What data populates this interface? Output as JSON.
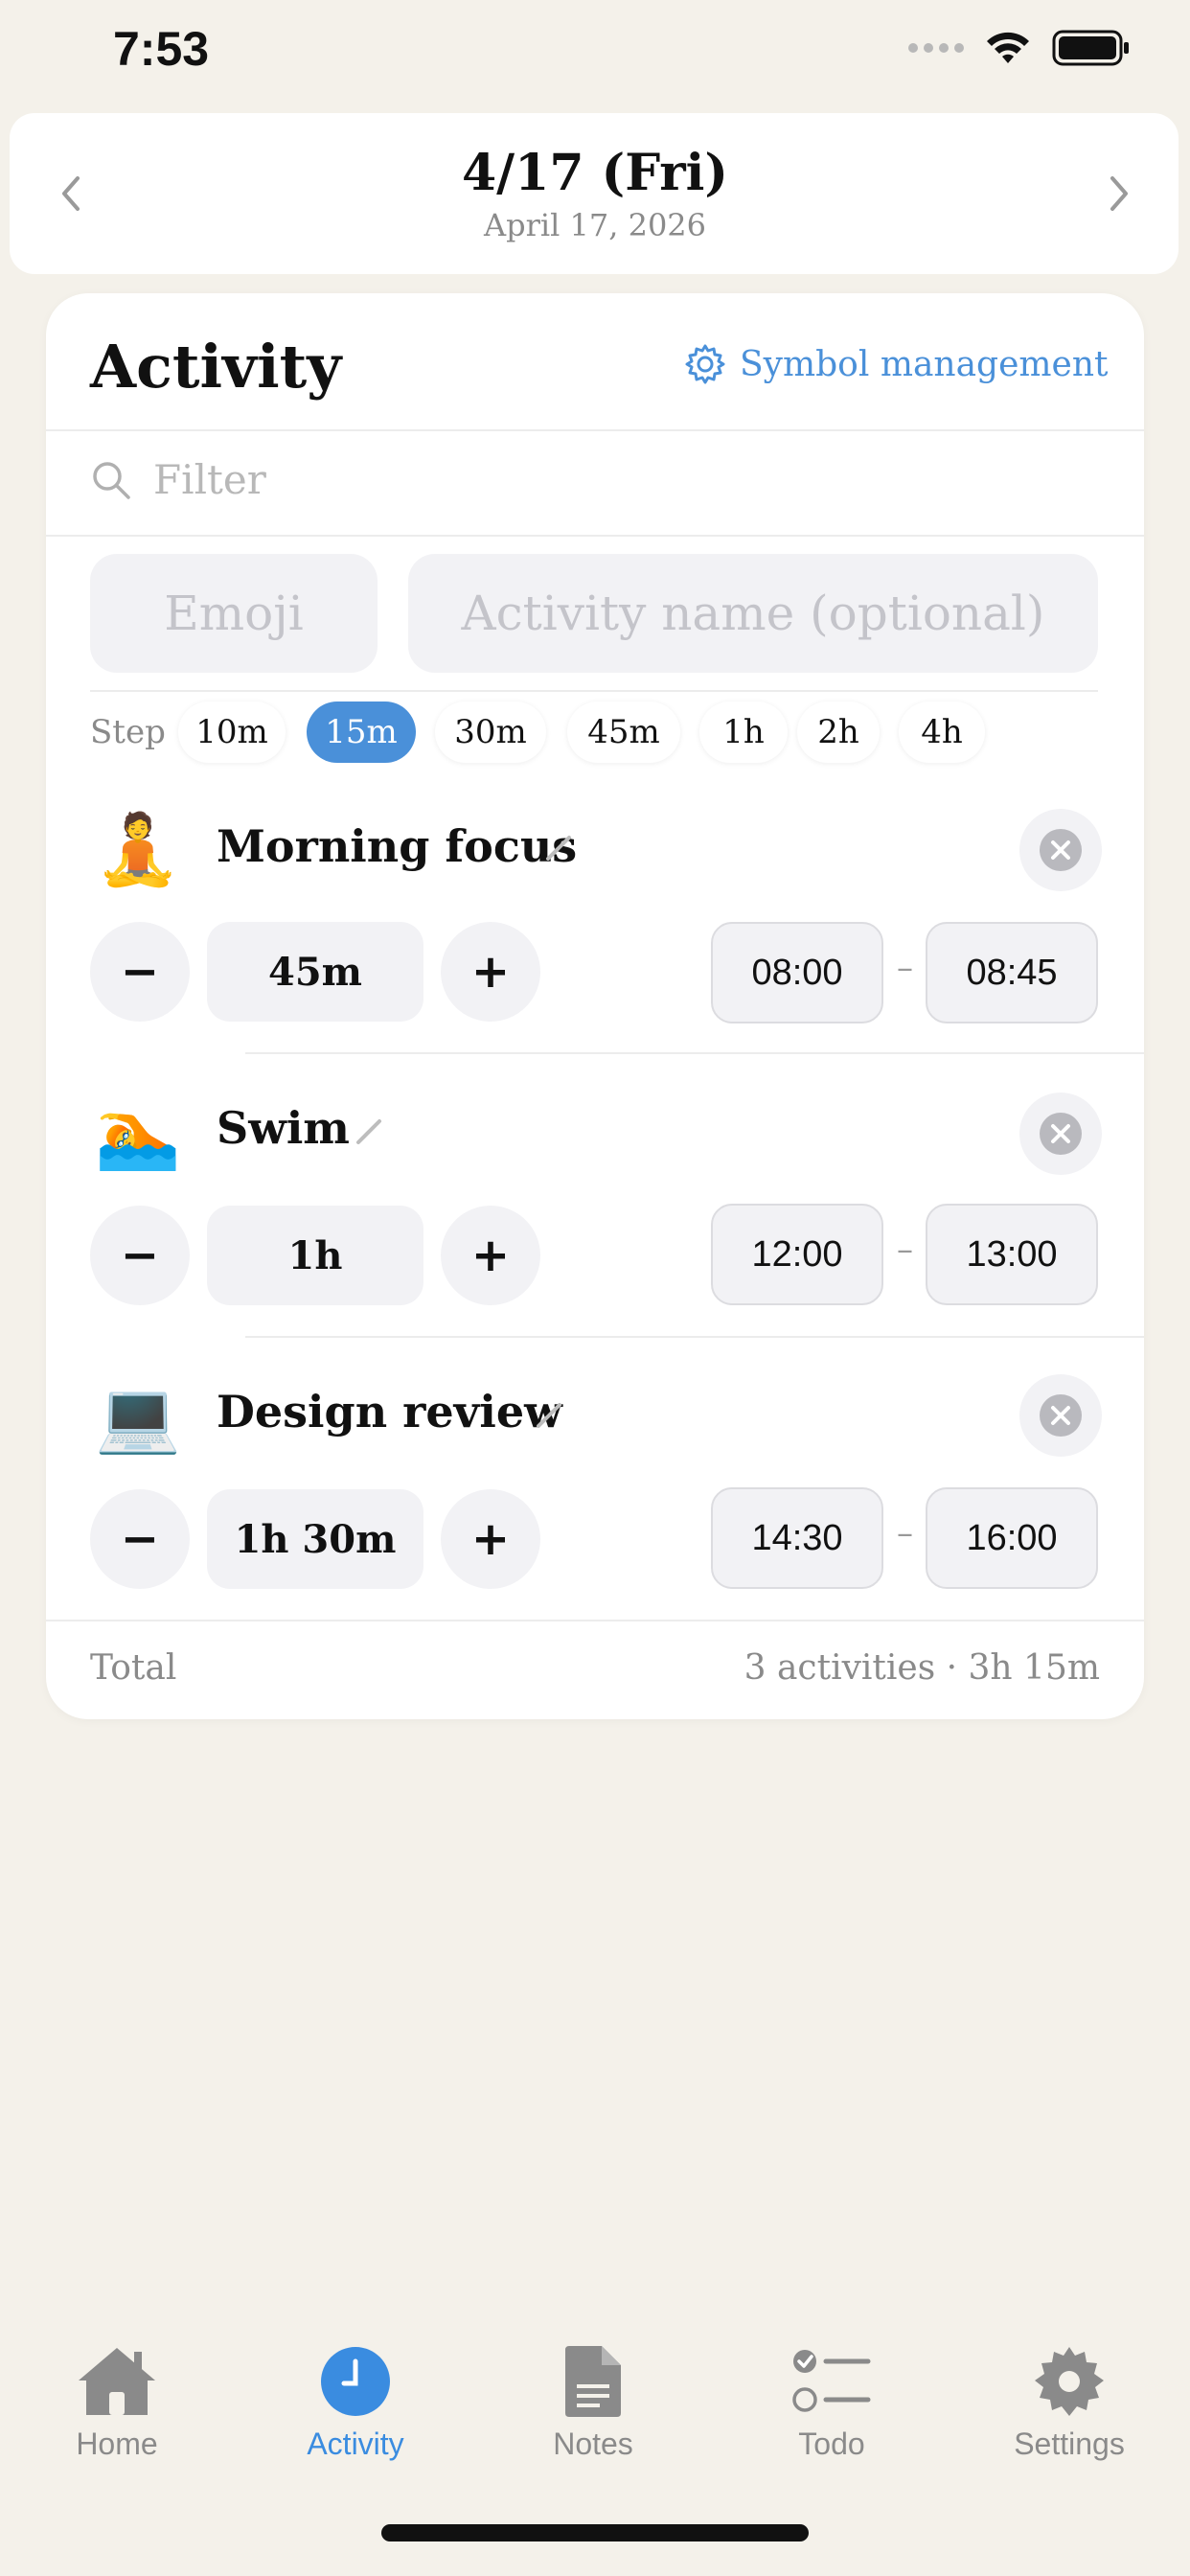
{
  "status_bar": {
    "time": "7:53"
  },
  "date_header": {
    "main": "4/17 (Fri)",
    "sub": "April 17, 2026"
  },
  "card": {
    "title": "Activity",
    "symbol_management": "Symbol management",
    "filter_placeholder": "Filter",
    "emoji_placeholder": "Emoji",
    "activity_name_placeholder": "Activity name (optional)",
    "step_label": "Step",
    "steps": [
      "10m",
      "15m",
      "30m",
      "45m",
      "1h",
      "2h",
      "4h"
    ],
    "active_step": "15m"
  },
  "activities": [
    {
      "emoji": "🧘",
      "name": "Morning focus",
      "duration": "45m",
      "start": "08:00",
      "end": "08:45"
    },
    {
      "emoji": "🏊",
      "name": "Swim",
      "duration": "1h",
      "start": "12:00",
      "end": "13:00"
    },
    {
      "emoji": "💻",
      "name": "Design review",
      "duration": "1h 30m",
      "start": "14:30",
      "end": "16:00"
    }
  ],
  "controls": {
    "minus": "−",
    "plus": "+",
    "dash": "–"
  },
  "total": {
    "label": "Total",
    "value": "3 activities · 3h 15m"
  },
  "tabs": [
    {
      "label": "Home",
      "icon": "home-icon"
    },
    {
      "label": "Activity",
      "icon": "clock-icon",
      "active": true
    },
    {
      "label": "Notes",
      "icon": "document-icon"
    },
    {
      "label": "Todo",
      "icon": "checklist-icon"
    },
    {
      "label": "Settings",
      "icon": "gear-icon"
    }
  ],
  "colors": {
    "accent": "#4A90D9",
    "background": "#F4F1EA",
    "tab_active": "#3A8CE0"
  }
}
